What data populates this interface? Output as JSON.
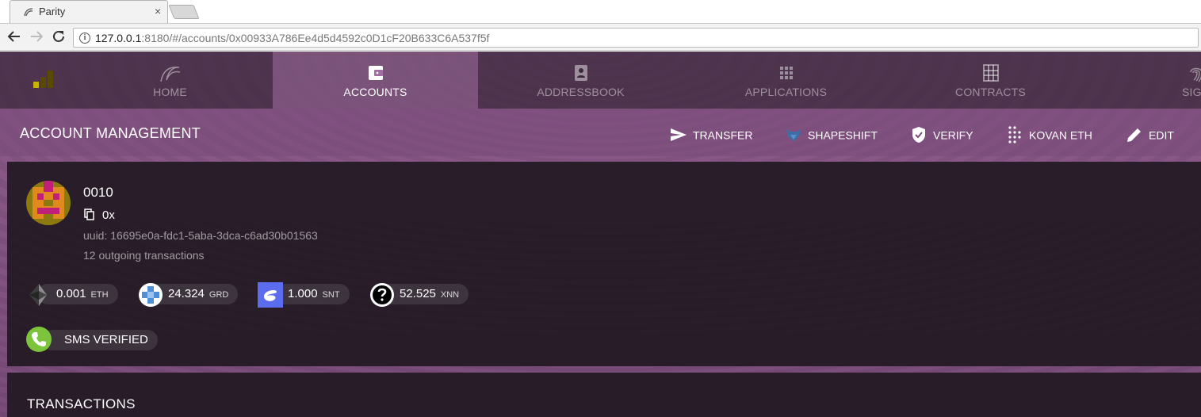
{
  "browser": {
    "tab_title": "Parity",
    "tab_close": "×",
    "url_host": "127.0.0.1",
    "url_rest": ":8180/#/accounts/0x00933A786Ee4d5d4592c0D1cF20B633C6A537f5f"
  },
  "nav": {
    "tabs": [
      {
        "label": "HOME",
        "icon": "parity-wave-icon"
      },
      {
        "label": "ACCOUNTS",
        "icon": "wallet-icon",
        "active": true
      },
      {
        "label": "ADDRESSBOOK",
        "icon": "contact-card-icon"
      },
      {
        "label": "APPLICATIONS",
        "icon": "apps-grid-icon"
      },
      {
        "label": "CONTRACTS",
        "icon": "table-grid-icon"
      },
      {
        "label": "SIGN",
        "icon": "fingerprint-icon"
      }
    ]
  },
  "titlebar": {
    "title": "ACCOUNT MANAGEMENT",
    "actions": [
      {
        "label": "TRANSFER",
        "icon": "send-icon"
      },
      {
        "label": "SHAPESHIFT",
        "icon": "fox-icon"
      },
      {
        "label": "VERIFY",
        "icon": "shield-check-icon"
      },
      {
        "label": "KOVAN ETH",
        "icon": "dots-grid-icon"
      },
      {
        "label": "EDIT",
        "icon": "pencil-icon"
      }
    ]
  },
  "account": {
    "name": "0010",
    "address": "0x",
    "uuid": "uuid: 16695e0a-fdc1-5aba-3dca-c6ad30b01563",
    "tx_count": "12 outgoing transactions",
    "tokens": [
      {
        "amount": "0.001",
        "symbol": "ETH",
        "icon": "ethereum-icon"
      },
      {
        "amount": "24.324",
        "symbol": "GRD",
        "icon": "gavcoin-icon"
      },
      {
        "amount": "1.000",
        "symbol": "SNT",
        "icon": "status-icon"
      },
      {
        "amount": "52.525",
        "symbol": "XNN",
        "icon": "unknown-token-icon"
      }
    ],
    "badge": {
      "label": "SMS VERIFIED",
      "icon": "phone-icon",
      "color": "#7cc43c"
    }
  },
  "transactions": {
    "title": "TRANSACTIONS"
  },
  "colors": {
    "accent": "#8e5c8c",
    "card": "#1c161e"
  }
}
